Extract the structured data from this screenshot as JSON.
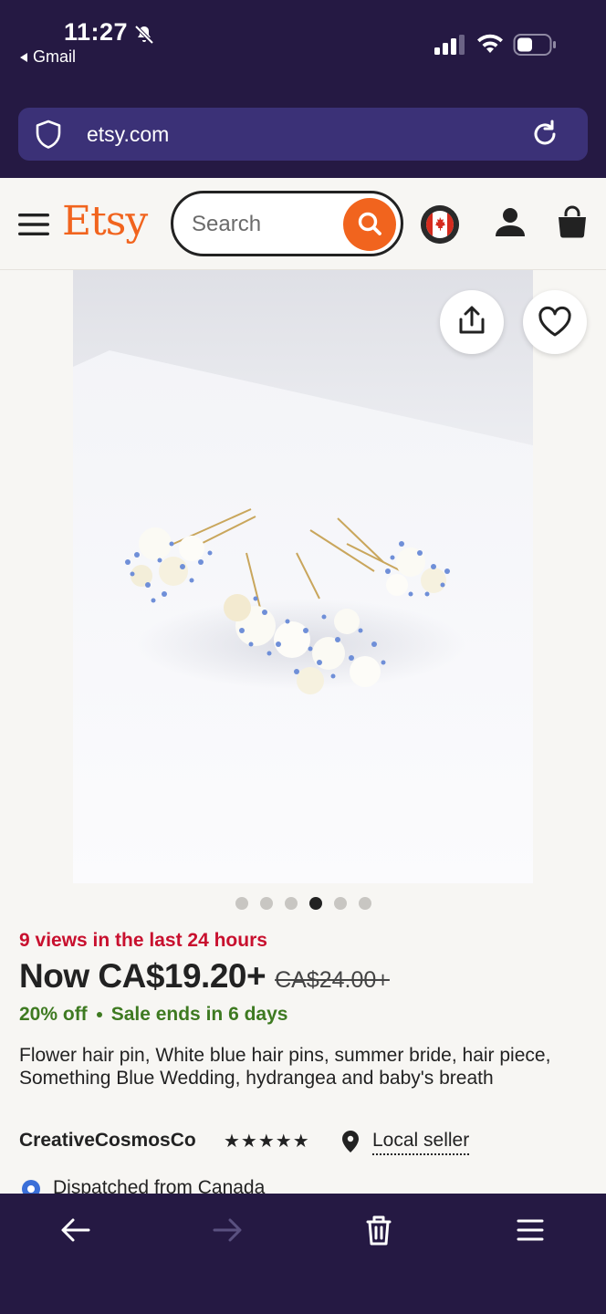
{
  "status_bar": {
    "time": "11:27",
    "back_app": "Gmail"
  },
  "browser": {
    "url": "etsy.com"
  },
  "header": {
    "logo": "Etsy",
    "search_placeholder": "Search"
  },
  "product": {
    "image_count": 6,
    "active_image_index": 3,
    "views": "9 views in the last 24 hours",
    "price_now": "Now CA$19.20+",
    "price_old": "CA$24.00+",
    "discount": "20% off",
    "sale_ends": "Sale ends in 6 days",
    "title": "Flower hair pin, White blue hair pins, summer bride, hair piece, Something Blue Wedding, hydrangea and baby's breath",
    "shop_name": "CreativeCosmosCo",
    "rating_stars": "★★★★★",
    "local_seller": "Local seller",
    "dispatch": "Dispatched from Canada"
  },
  "colors": {
    "brand": "#f1641e",
    "browser_chrome": "#251943",
    "views_red": "#c8102e",
    "sale_green": "#3e7a21"
  }
}
